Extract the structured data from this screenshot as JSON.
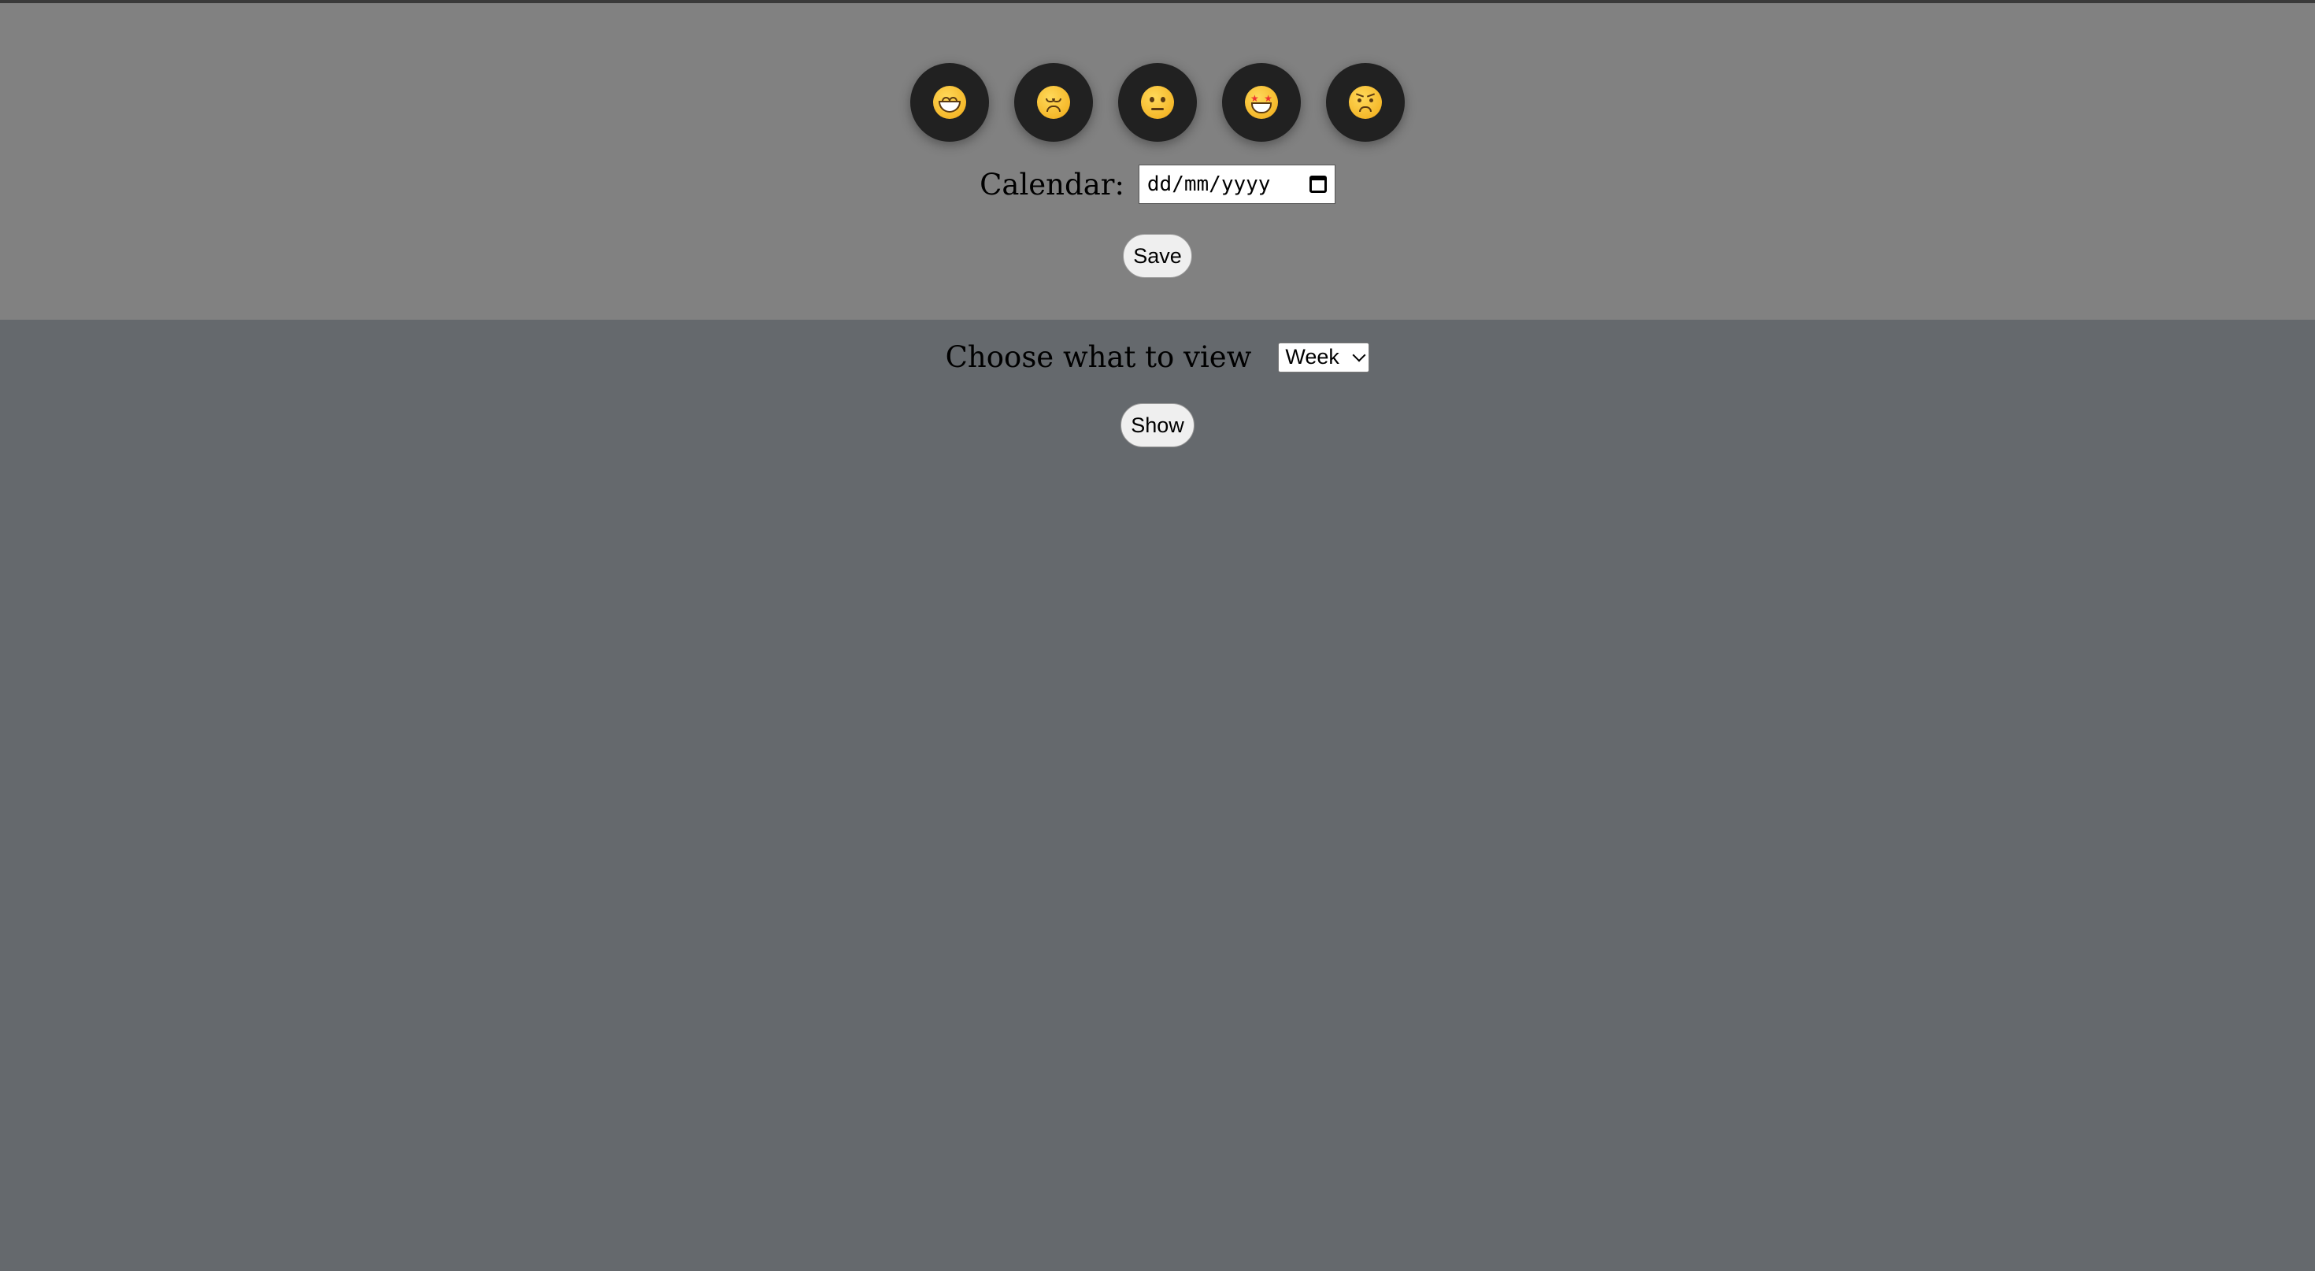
{
  "moods": [
    {
      "icon": "grinning-face-icon",
      "variant": "grin"
    },
    {
      "icon": "disappointed-face-icon",
      "variant": "sad"
    },
    {
      "icon": "neutral-face-icon",
      "variant": "neutral"
    },
    {
      "icon": "star-struck-face-icon",
      "variant": "star"
    },
    {
      "icon": "angry-face-icon",
      "variant": "angry"
    }
  ],
  "calendar": {
    "label": "Calendar:",
    "placeholder": "dd/mm/yyyy",
    "icon": "calendar-icon"
  },
  "save_label": "Save",
  "view": {
    "label": "Choose what to view",
    "selected": "Week"
  },
  "show_label": "Show",
  "colors": {
    "top_panel": "#818181",
    "page_background": "#65696d",
    "mood_button": "#212121"
  }
}
